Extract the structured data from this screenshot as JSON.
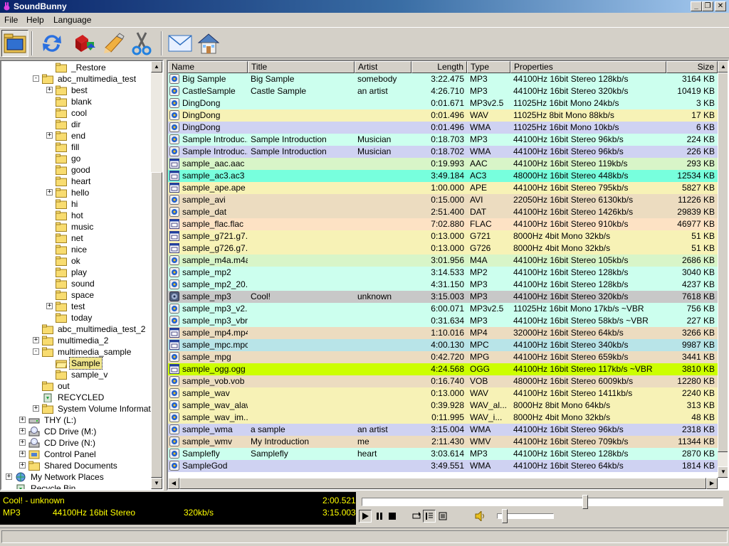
{
  "window": {
    "title": "SoundBunny"
  },
  "menu": {
    "file": "File",
    "help": "Help",
    "language": "Language"
  },
  "toolbar": {
    "icons": [
      "folder-browse-icon",
      "refresh-icon",
      "convert-icon",
      "tag-edit-icon",
      "cut-icon",
      "mail-icon",
      "home-icon"
    ]
  },
  "tree": {
    "items": [
      {
        "label": "_Restore",
        "depth": 3,
        "expander": "",
        "icon": "folder"
      },
      {
        "label": "abc_multimedia_test",
        "depth": 2,
        "expander": "-",
        "icon": "folder"
      },
      {
        "label": "best",
        "depth": 3,
        "expander": "+",
        "icon": "folder"
      },
      {
        "label": "blank",
        "depth": 3,
        "expander": "",
        "icon": "folder"
      },
      {
        "label": "cool",
        "depth": 3,
        "expander": "",
        "icon": "folder"
      },
      {
        "label": "dir",
        "depth": 3,
        "expander": "",
        "icon": "folder"
      },
      {
        "label": "end",
        "depth": 3,
        "expander": "+",
        "icon": "folder"
      },
      {
        "label": "fill",
        "depth": 3,
        "expander": "",
        "icon": "folder"
      },
      {
        "label": "go",
        "depth": 3,
        "expander": "",
        "icon": "folder"
      },
      {
        "label": "good",
        "depth": 3,
        "expander": "",
        "icon": "folder"
      },
      {
        "label": "heart",
        "depth": 3,
        "expander": "",
        "icon": "folder"
      },
      {
        "label": "hello",
        "depth": 3,
        "expander": "+",
        "icon": "folder"
      },
      {
        "label": "hi",
        "depth": 3,
        "expander": "",
        "icon": "folder"
      },
      {
        "label": "hot",
        "depth": 3,
        "expander": "",
        "icon": "folder"
      },
      {
        "label": "music",
        "depth": 3,
        "expander": "",
        "icon": "folder"
      },
      {
        "label": "net",
        "depth": 3,
        "expander": "",
        "icon": "folder"
      },
      {
        "label": "nice",
        "depth": 3,
        "expander": "",
        "icon": "folder"
      },
      {
        "label": "ok",
        "depth": 3,
        "expander": "",
        "icon": "folder"
      },
      {
        "label": "play",
        "depth": 3,
        "expander": "",
        "icon": "folder"
      },
      {
        "label": "sound",
        "depth": 3,
        "expander": "",
        "icon": "folder"
      },
      {
        "label": "space",
        "depth": 3,
        "expander": "",
        "icon": "folder"
      },
      {
        "label": "test",
        "depth": 3,
        "expander": "+",
        "icon": "folder"
      },
      {
        "label": "today",
        "depth": 3,
        "expander": "",
        "icon": "folder"
      },
      {
        "label": "abc_multimedia_test_2",
        "depth": 2,
        "expander": "",
        "icon": "folder"
      },
      {
        "label": "multimedia_2",
        "depth": 2,
        "expander": "+",
        "icon": "folder"
      },
      {
        "label": "multimedia_sample",
        "depth": 2,
        "expander": "-",
        "icon": "folder"
      },
      {
        "label": "Sample",
        "depth": 3,
        "expander": "",
        "icon": "folder-open",
        "selected": true
      },
      {
        "label": "sample_v",
        "depth": 3,
        "expander": "",
        "icon": "folder"
      },
      {
        "label": "out",
        "depth": 2,
        "expander": "",
        "icon": "folder"
      },
      {
        "label": "RECYCLED",
        "depth": 2,
        "expander": "",
        "icon": "recycle"
      },
      {
        "label": "System Volume Information",
        "depth": 2,
        "expander": "+",
        "icon": "folder"
      },
      {
        "label": "THY (L:)",
        "depth": 1,
        "expander": "+",
        "icon": "drive"
      },
      {
        "label": "CD Drive (M:)",
        "depth": 1,
        "expander": "+",
        "icon": "cd"
      },
      {
        "label": "CD Drive (N:)",
        "depth": 1,
        "expander": "+",
        "icon": "cd"
      },
      {
        "label": "Control Panel",
        "depth": 1,
        "expander": "+",
        "icon": "control"
      },
      {
        "label": "Shared Documents",
        "depth": 1,
        "expander": "+",
        "icon": "folder"
      },
      {
        "label": "My Network Places",
        "depth": 0,
        "expander": "+",
        "icon": "network"
      },
      {
        "label": "Recycle Bin",
        "depth": 0,
        "expander": "",
        "icon": "recycle"
      }
    ]
  },
  "list": {
    "columns": [
      "Name",
      "Title",
      "Artist",
      "Length",
      "Type",
      "Properties",
      "Size"
    ],
    "rows": [
      {
        "name": "Big Sample",
        "title": "Big Sample",
        "artist": "somebody",
        "length": "3:22.475",
        "type": "MP3",
        "props": "44100Hz 16bit Stereo 128kb/s",
        "size": "3164 KB",
        "bg": "#ccffee",
        "icon": "audio"
      },
      {
        "name": "CastleSample",
        "title": "Castle Sample",
        "artist": "an artist",
        "length": "4:26.710",
        "type": "MP3",
        "props": "44100Hz 16bit Stereo 320kb/s",
        "size": "10419 KB",
        "bg": "#ccffee",
        "icon": "audio"
      },
      {
        "name": "DingDong",
        "title": "",
        "artist": "",
        "length": "0:01.671",
        "type": "MP3v2.5",
        "props": "11025Hz 16bit Mono 24kb/s",
        "size": "3 KB",
        "bg": "#ccffee",
        "icon": "audio"
      },
      {
        "name": "DingDong",
        "title": "",
        "artist": "",
        "length": "0:01.496",
        "type": "WAV",
        "props": "11025Hz  8bit Mono 88kb/s",
        "size": "17 KB",
        "bg": "#f7f2b6",
        "icon": "audio"
      },
      {
        "name": "DingDong",
        "title": "",
        "artist": "",
        "length": "0:01.496",
        "type": "WMA",
        "props": "11025Hz 16bit Mono 10kb/s",
        "size": "6 KB",
        "bg": "#cfd2f2",
        "icon": "audio"
      },
      {
        "name": "Sample Introduc...",
        "title": "Sample Introduction",
        "artist": "Musician",
        "length": "0:18.703",
        "type": "MP3",
        "props": "44100Hz 16bit Stereo 96kb/s",
        "size": "224 KB",
        "bg": "#ccffee",
        "icon": "audio"
      },
      {
        "name": "Sample Introduc...",
        "title": "Sample Introduction",
        "artist": "Musician",
        "length": "0:18.702",
        "type": "WMA",
        "props": "44100Hz 16bit Stereo 96kb/s",
        "size": "226 KB",
        "bg": "#cfd2f2",
        "icon": "audio"
      },
      {
        "name": "sample_aac.aac",
        "title": "",
        "artist": "",
        "length": "0:19.993",
        "type": "AAC",
        "props": "44100Hz 16bit Stereo 119kb/s",
        "size": "293 KB",
        "bg": "#d8f5c8",
        "icon": "file"
      },
      {
        "name": "sample_ac3.ac3",
        "title": "",
        "artist": "",
        "length": "3:49.184",
        "type": "AC3",
        "props": "48000Hz 16bit Stereo 448kb/s",
        "size": "12534 KB",
        "bg": "#77ffdd",
        "icon": "file"
      },
      {
        "name": "sample_ape.ape",
        "title": "",
        "artist": "",
        "length": "1:00.000",
        "type": "APE",
        "props": "44100Hz 16bit Stereo 795kb/s",
        "size": "5827 KB",
        "bg": "#f7f2b6",
        "icon": "file"
      },
      {
        "name": "sample_avi",
        "title": "",
        "artist": "",
        "length": "0:15.000",
        "type": "AVI",
        "props": "22050Hz 16bit Stereo 6130kb/s",
        "size": "11226 KB",
        "bg": "#ecdcc0",
        "icon": "audio"
      },
      {
        "name": "sample_dat",
        "title": "",
        "artist": "",
        "length": "2:51.400",
        "type": "DAT",
        "props": "44100Hz 16bit Stereo 1426kb/s",
        "size": "29839 KB",
        "bg": "#ecdcc0",
        "icon": "audio"
      },
      {
        "name": "sample_flac.flac",
        "title": "",
        "artist": "",
        "length": "7:02.880",
        "type": "FLAC",
        "props": "44100Hz 16bit Stereo 910kb/s",
        "size": "46977 KB",
        "bg": "#fde2c4",
        "icon": "file"
      },
      {
        "name": "sample_g721.g7...",
        "title": "",
        "artist": "",
        "length": "0:13.000",
        "type": "G721",
        "props": "8000Hz  4bit Mono 32kb/s",
        "size": "51 KB",
        "bg": "#f7f2b6",
        "icon": "file"
      },
      {
        "name": "sample_g726.g7...",
        "title": "",
        "artist": "",
        "length": "0:13.000",
        "type": "G726",
        "props": "8000Hz  4bit Mono 32kb/s",
        "size": "51 KB",
        "bg": "#f7f2b6",
        "icon": "file"
      },
      {
        "name": "sample_m4a.m4a",
        "title": "",
        "artist": "",
        "length": "3:01.956",
        "type": "M4A",
        "props": "44100Hz 16bit Stereo 105kb/s",
        "size": "2686 KB",
        "bg": "#d8f5c8",
        "icon": "audio"
      },
      {
        "name": "sample_mp2",
        "title": "",
        "artist": "",
        "length": "3:14.533",
        "type": "MP2",
        "props": "44100Hz 16bit Stereo 128kb/s",
        "size": "3040 KB",
        "bg": "#ccffee",
        "icon": "audio"
      },
      {
        "name": "sample_mp2_20...",
        "title": "",
        "artist": "",
        "length": "4:31.150",
        "type": "MP3",
        "props": "44100Hz 16bit Stereo 128kb/s",
        "size": "4237 KB",
        "bg": "#ccffee",
        "icon": "audio"
      },
      {
        "name": "sample_mp3",
        "title": "Cool!",
        "artist": "unknown",
        "length": "3:15.003",
        "type": "MP3",
        "props": "44100Hz 16bit Stereo 320kb/s",
        "size": "7618 KB",
        "bg": "#c8c8c8",
        "icon": "audio-dark"
      },
      {
        "name": "sample_mp3_v2.5",
        "title": "",
        "artist": "",
        "length": "6:00.071",
        "type": "MP3v2.5",
        "props": "11025Hz 16bit Mono 17kb/s ~VBR",
        "size": "756 KB",
        "bg": "#ccffee",
        "icon": "audio"
      },
      {
        "name": "sample_mp3_vbr",
        "title": "",
        "artist": "",
        "length": "0:31.634",
        "type": "MP3",
        "props": "44100Hz 16bit Stereo 58kb/s ~VBR",
        "size": "227 KB",
        "bg": "#ccffee",
        "icon": "audio"
      },
      {
        "name": "sample_mp4.mp4",
        "title": "",
        "artist": "",
        "length": "1:10.016",
        "type": "MP4",
        "props": "32000Hz 16bit Stereo 64kb/s",
        "size": "3266 KB",
        "bg": "#ecdcc0",
        "icon": "file"
      },
      {
        "name": "sample_mpc.mpc",
        "title": "",
        "artist": "",
        "length": "4:00.130",
        "type": "MPC",
        "props": "44100Hz 16bit Stereo 340kb/s",
        "size": "9987 KB",
        "bg": "#b8e4e8",
        "icon": "file"
      },
      {
        "name": "sample_mpg",
        "title": "",
        "artist": "",
        "length": "0:42.720",
        "type": "MPG",
        "props": "44100Hz 16bit Stereo 659kb/s",
        "size": "3441 KB",
        "bg": "#ecdcc0",
        "icon": "audio"
      },
      {
        "name": "sample_ogg.ogg",
        "title": "",
        "artist": "",
        "length": "4:24.568",
        "type": "OGG",
        "props": "44100Hz 16bit Stereo 117kb/s ~VBR",
        "size": "3810 KB",
        "bg": "#ccff00",
        "icon": "file"
      },
      {
        "name": "sample_vob.vob",
        "title": "",
        "artist": "",
        "length": "0:16.740",
        "type": "VOB",
        "props": "48000Hz 16bit Stereo 6009kb/s",
        "size": "12280 KB",
        "bg": "#ecdcc0",
        "icon": "audio"
      },
      {
        "name": "sample_wav",
        "title": "",
        "artist": "",
        "length": "0:13.000",
        "type": "WAV",
        "props": "44100Hz 16bit Stereo 1411kb/s",
        "size": "2240 KB",
        "bg": "#f7f2b6",
        "icon": "audio"
      },
      {
        "name": "sample_wav_alaw",
        "title": "",
        "artist": "",
        "length": "0:39.928",
        "type": "WAV_al...",
        "props": "8000Hz  8bit Mono 64kb/s",
        "size": "313 KB",
        "bg": "#f7f2b6",
        "icon": "audio"
      },
      {
        "name": "sample_wav_im...",
        "title": "",
        "artist": "",
        "length": "0:11.995",
        "type": "WAV_i...",
        "props": "8000Hz  4bit Mono 32kb/s",
        "size": "48 KB",
        "bg": "#f7f2b6",
        "icon": "audio"
      },
      {
        "name": "sample_wma",
        "title": "a sample",
        "artist": "an artist",
        "length": "3:15.004",
        "type": "WMA",
        "props": "44100Hz 16bit Stereo 96kb/s",
        "size": "2318 KB",
        "bg": "#cfd2f2",
        "icon": "audio"
      },
      {
        "name": "sample_wmv",
        "title": "My Introduction",
        "artist": "me",
        "length": "2:11.430",
        "type": "WMV",
        "props": "44100Hz 16bit Stereo 709kb/s",
        "size": "11344 KB",
        "bg": "#ecdcc0",
        "icon": "audio"
      },
      {
        "name": "Samplefly",
        "title": "Samplefly",
        "artist": "heart",
        "length": "3:03.614",
        "type": "MP3",
        "props": "44100Hz 16bit Stereo 128kb/s",
        "size": "2870 KB",
        "bg": "#ccffee",
        "icon": "audio"
      },
      {
        "name": "SampleGod",
        "title": "",
        "artist": "",
        "length": "3:49.551",
        "type": "WMA",
        "props": "44100Hz 16bit Stereo 64kb/s",
        "size": "1814 KB",
        "bg": "#cfd2f2",
        "icon": "audio"
      }
    ]
  },
  "player": {
    "now_playing": "Cool! - unknown",
    "elapsed": "2:00.521",
    "format": "MP3",
    "props": "44100Hz 16bit Stereo",
    "bitrate": "320kb/s",
    "total": "3:15.003",
    "seek_fraction": 0.62,
    "volume_fraction": 0.1
  },
  "colors": {
    "accent_title": "#0a246a",
    "player_text": "#ffff00"
  }
}
